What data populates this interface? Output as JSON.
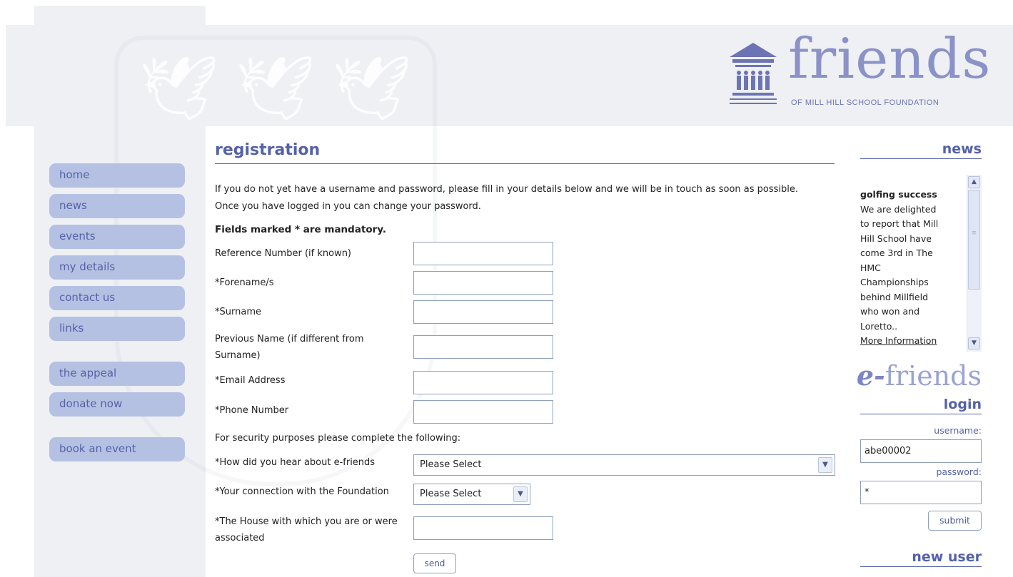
{
  "logo": {
    "word": "friends",
    "subtitle": "OF MILL HILL SCHOOL FOUNDATION",
    "icon": "building-with-people-icon"
  },
  "nav": {
    "items": [
      {
        "label": "home"
      },
      {
        "label": "news"
      },
      {
        "label": "events"
      },
      {
        "label": "my details"
      },
      {
        "label": "contact us"
      },
      {
        "label": "links"
      }
    ],
    "appeal_items": [
      {
        "label": "the appeal"
      },
      {
        "label": "donate now"
      }
    ],
    "event_items": [
      {
        "label": "book an event"
      }
    ]
  },
  "main": {
    "title": "registration",
    "intro_line1": "If you do not yet have a username and password, please fill in your details below and we will be in touch as soon as possible.",
    "intro_line2": "Once you have logged in you can change your password.",
    "mandatory_note": "Fields marked * are mandatory.",
    "fields": [
      {
        "label": "Reference Number (if known)",
        "value": ""
      },
      {
        "label": "*Forename/s",
        "value": ""
      },
      {
        "label": "*Surname",
        "value": ""
      },
      {
        "label": "Previous Name (if different from Surname)",
        "value": ""
      },
      {
        "label": "*Email Address",
        "value": ""
      },
      {
        "label": "*Phone Number",
        "value": ""
      }
    ],
    "security_note": "For security purposes please complete the following:",
    "heard_about": {
      "label": "*How did you hear about e-friends",
      "selected": "Please Select"
    },
    "connection": {
      "label": "*Your connection with the Foundation",
      "selected": "Please Select"
    },
    "house": {
      "label": "*The House with which you are or were associated",
      "value": ""
    },
    "send_label": "send"
  },
  "sidebar": {
    "news_heading": "news",
    "news_item": {
      "title": "golfing success",
      "body": "We are delighted to report that Mill Hill School have come 3rd in The HMC Championships behind Millfield who won and Loretto..",
      "more": "More Information"
    },
    "efriends_prefix": "e-",
    "efriends_word": "friends",
    "login_heading": "login",
    "username_label": "username:",
    "username_value": "abe00002",
    "password_label": "password:",
    "password_value": "*",
    "submit_label": "submit",
    "new_user_heading": "new user"
  },
  "colors": {
    "accent": "#5561a8",
    "nav_bg": "#b5c1e2",
    "panel_bg": "#eef0f4"
  }
}
